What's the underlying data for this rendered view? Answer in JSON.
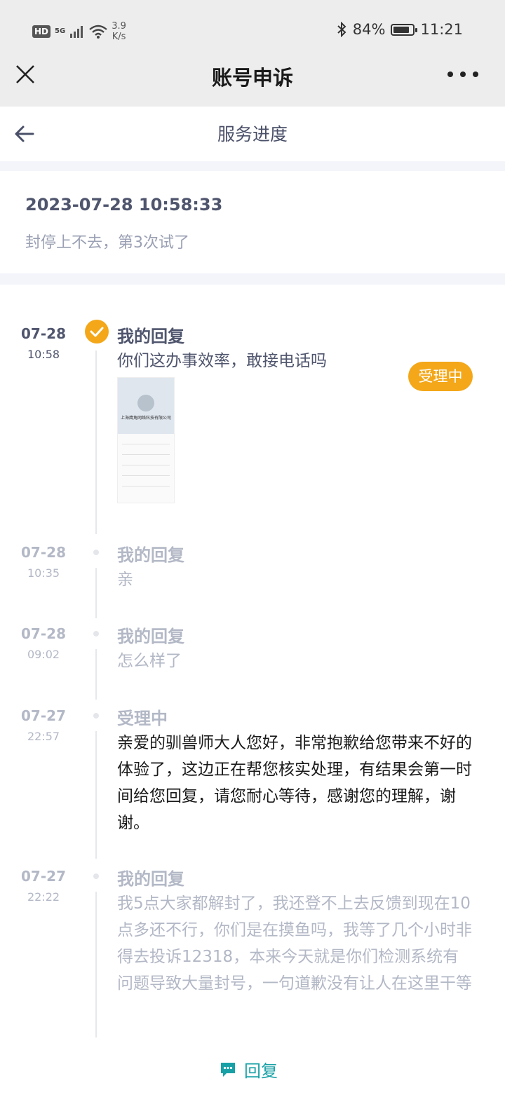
{
  "status_bar": {
    "hd": "HD",
    "network": "5G",
    "speed_value": "3.9",
    "speed_unit": "K/s",
    "battery": "84%",
    "battery_level": 0.84,
    "time": "11:21"
  },
  "title_bar": {
    "title": "账号申诉"
  },
  "nav_bar": {
    "title": "服务进度"
  },
  "ticket": {
    "datetime": "2023-07-28 10:58:33",
    "status": "受理中",
    "description": "封停上不去，第3次试了"
  },
  "timeline": [
    {
      "date": "07-28",
      "time": "10:58",
      "title": "我的回复",
      "body": "你们这办事效率，敢接电话吗",
      "has_attachment": true,
      "active": true
    },
    {
      "date": "07-28",
      "time": "10:35",
      "title": "我的回复",
      "body": "亲"
    },
    {
      "date": "07-28",
      "time": "09:02",
      "title": "我的回复",
      "body": "怎么样了"
    },
    {
      "date": "07-27",
      "time": "22:57",
      "title": "受理中",
      "body": "亲爱的驯兽师大人您好，非常抱歉给您带来不好的体验了，这边正在帮您核实处理，有结果会第一时间给您回复，请您耐心等待，感谢您的理解，谢谢。"
    },
    {
      "date": "07-27",
      "time": "22:22",
      "title": "我的回复",
      "body": "我5点大家都解封了，我还登不上去反馈到现在10点多还不行，你们是在摸鱼吗，我等了几个小时非得去投诉12318，本来今天就是你们检测系统有问题导致大量封号，一句道歉没有让人在这里干等"
    }
  ],
  "attachment": {
    "company": "上海鹰角网络科技有限公司"
  },
  "reply_button": {
    "label": "回复"
  },
  "colors": {
    "accent": "#f3a719",
    "reply": "#17a1a6",
    "muted": "#9aa0b3"
  }
}
